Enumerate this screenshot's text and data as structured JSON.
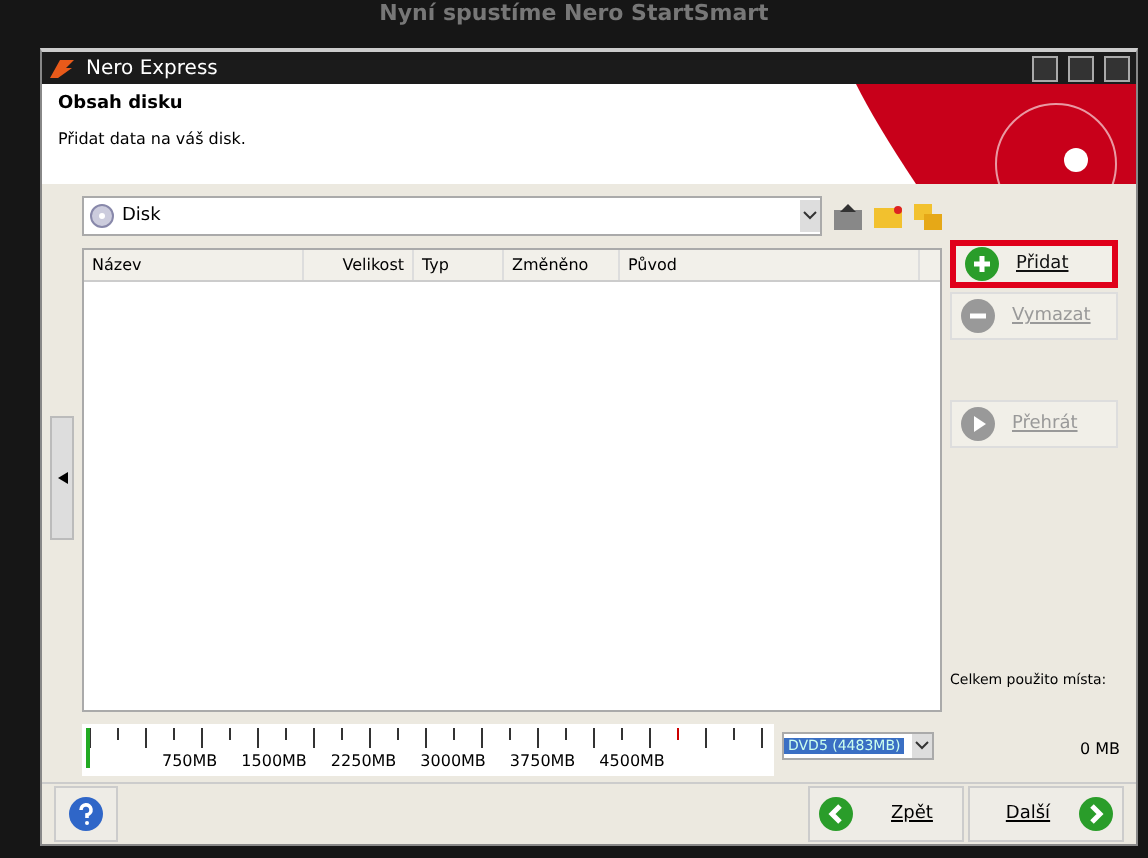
{
  "caption": "Nyní spustíme Nero StartSmart",
  "window": {
    "title": "Nero Express"
  },
  "header": {
    "title": "Obsah disku",
    "subtitle": "Přidat data na váš disk."
  },
  "disk_select": {
    "value": "Disk"
  },
  "table": {
    "columns": [
      "Název",
      "Velikost",
      "Typ",
      "Změněno",
      "Původ"
    ]
  },
  "side_buttons": [
    {
      "label": "Přidat",
      "kind": "add",
      "disabled": false,
      "highlighted": true
    },
    {
      "label": "Vymazat",
      "kind": "remove",
      "disabled": true,
      "highlighted": false
    },
    {
      "label": "Přehrát",
      "kind": "play",
      "disabled": true,
      "highlighted": false
    }
  ],
  "usage": {
    "label": "Celkem použito místa:",
    "value": "0 MB"
  },
  "ruler": {
    "labels": [
      "750MB",
      "1500MB",
      "2250MB",
      "3000MB",
      "3750MB",
      "4500MB"
    ],
    "level": 0
  },
  "media_select": {
    "value": "DVD5 (4483MB)"
  },
  "footer": {
    "back": "Zpět",
    "next": "Další"
  }
}
